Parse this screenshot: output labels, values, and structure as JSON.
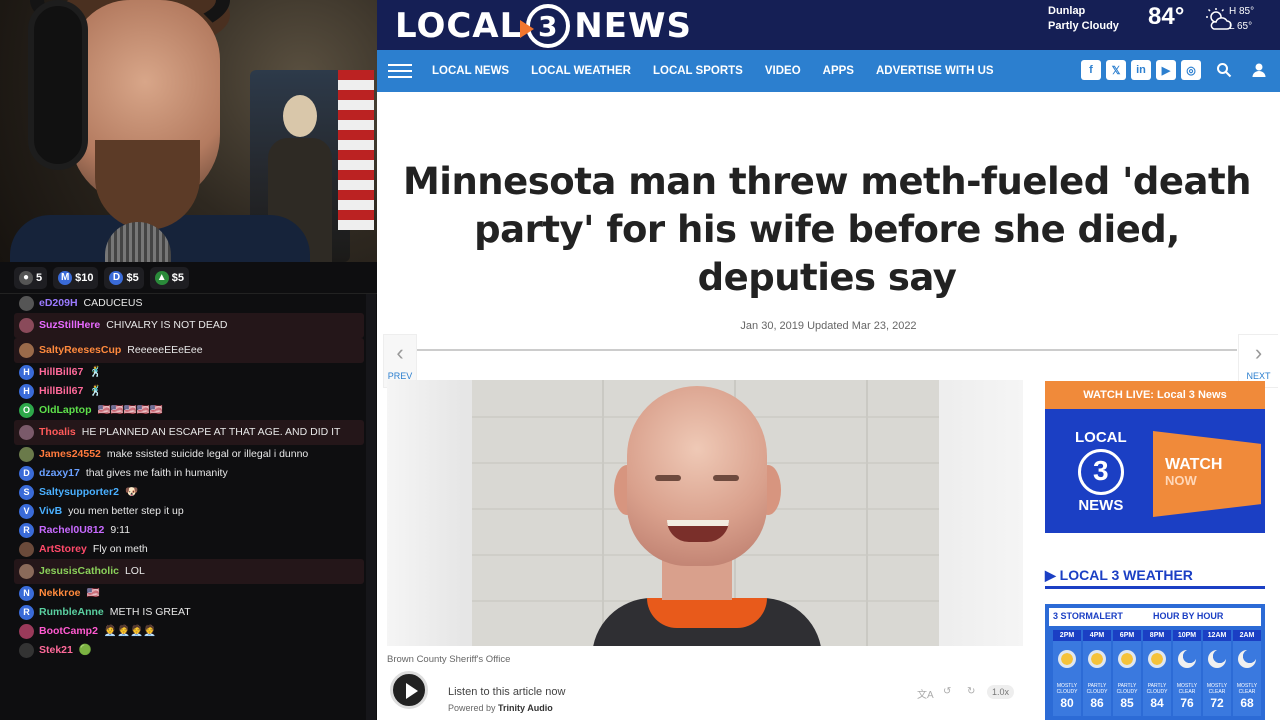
{
  "gifters": [
    {
      "icon": "steam-icon",
      "amount": "5",
      "color": "#555"
    },
    {
      "icon": "m-icon",
      "amount": "$10",
      "color": "#3a6bd8"
    },
    {
      "icon": "d-icon",
      "amount": "$5",
      "color": "#3a6bd8"
    },
    {
      "icon": "tree-icon",
      "amount": "$5",
      "color": "#2a8a3a"
    }
  ],
  "chat": [
    {
      "user": "eD209H",
      "color": "#9b7bff",
      "text": "CADUCEUS",
      "avatar_color": "#555",
      "avatar_letter": "",
      "highlight": false
    },
    {
      "user": "SuzStillHere",
      "color": "#e86aff",
      "text": "CHIVALRY IS NOT DEAD",
      "avatar_color": "#8a4a5a",
      "avatar_letter": "",
      "highlight": true
    },
    {
      "user": "SaltyReesesCup",
      "color": "#ff8a3d",
      "text": "ReeeeeEEeEee",
      "avatar_color": "#9a6a4a",
      "avatar_letter": "",
      "highlight": true
    },
    {
      "user": "HillBill67",
      "color": "#ff6a9a",
      "text": "🕺",
      "avatar_color": "#3a6bd8",
      "avatar_letter": "H",
      "highlight": false
    },
    {
      "user": "HillBill67",
      "color": "#ff6a9a",
      "text": "🕺",
      "avatar_color": "#3a6bd8",
      "avatar_letter": "H",
      "highlight": false
    },
    {
      "user": "OldLaptop",
      "color": "#5de04a",
      "text": "🇺🇸🇺🇸🇺🇸🇺🇸🇺🇸",
      "avatar_color": "#2ea84a",
      "avatar_letter": "O",
      "highlight": false
    },
    {
      "user": "Thoalis",
      "color": "#ff5a5a",
      "text": "HE PLANNED AN ESCAPE AT THAT AGE. AND DID IT",
      "avatar_color": "#7a5a6a",
      "avatar_letter": "",
      "highlight": true
    },
    {
      "user": "James24552",
      "color": "#ff7a3d",
      "text": "make ssisted suicide legal or illegal i dunno",
      "avatar_color": "#6a7a4a",
      "avatar_letter": "",
      "highlight": false
    },
    {
      "user": "dzaxy17",
      "color": "#6aa0ff",
      "text": "that gives me faith in humanity",
      "avatar_color": "#3a6bd8",
      "avatar_letter": "D",
      "highlight": false
    },
    {
      "user": "Saltysupporter2",
      "color": "#4ab0ff",
      "text": "🐶",
      "avatar_color": "#3a6bd8",
      "avatar_letter": "S",
      "highlight": false
    },
    {
      "user": "VivB",
      "color": "#4ab0ff",
      "text": "you men better step it up",
      "avatar_color": "#3a6bd8",
      "avatar_letter": "V",
      "highlight": false
    },
    {
      "user": "Rachel0U812",
      "color": "#c86aff",
      "text": "9:11",
      "avatar_color": "#3a6bd8",
      "avatar_letter": "R",
      "highlight": false
    },
    {
      "user": "ArtStorey",
      "color": "#ff4a6a",
      "text": "Fly on meth",
      "avatar_color": "#6a4a3a",
      "avatar_letter": "",
      "highlight": false
    },
    {
      "user": "JesusisCatholic",
      "color": "#8ad05a",
      "text": "LOL",
      "avatar_color": "#8a6a5a",
      "avatar_letter": "",
      "highlight": true
    },
    {
      "user": "Nekkroe",
      "color": "#ff8a3d",
      "text": "🇺🇸",
      "avatar_color": "#3a6bd8",
      "avatar_letter": "N",
      "highlight": false
    },
    {
      "user": "RumbleAnne",
      "color": "#5ad0a0",
      "text": "METH IS GREAT",
      "avatar_color": "#3a6bd8",
      "avatar_letter": "R",
      "highlight": false
    },
    {
      "user": "BootCamp2",
      "color": "#ff5ad0",
      "text": "🧑‍💼🧑‍💼🧑‍💼🧑‍💼",
      "avatar_color": "#9a3a5a",
      "avatar_letter": "",
      "highlight": false
    },
    {
      "user": "Stek21",
      "color": "#ff6a9a",
      "text": "🟢",
      "avatar_color": "#333",
      "avatar_letter": "",
      "highlight": false
    }
  ],
  "site": {
    "logo_left": "LOCAL",
    "logo_num": "3",
    "logo_right": "NEWS",
    "weather": {
      "city": "Dunlap",
      "condition": "Partly Cloudy",
      "temp": "84°",
      "high": "H 85°",
      "low": "L 65°"
    },
    "nav": [
      "LOCAL NEWS",
      "LOCAL WEATHER",
      "LOCAL SPORTS",
      "VIDEO",
      "APPS",
      "ADVERTISE WITH US"
    ],
    "social": [
      "f",
      "𝕏",
      "in",
      "▶",
      "◎"
    ],
    "headline": "Minnesota man threw meth-fueled 'death party' for his wife before she died, deputies say",
    "dateline": "Jan 30, 2019 Updated Mar 23, 2022",
    "prev_label": "PREV",
    "next_label": "NEXT",
    "photo_credit": "Brown County Sheriff's Office",
    "audio": {
      "listen": "Listen to this article now",
      "powered_prefix": "Powered by",
      "powered_brand": "Trinity Audio",
      "speed": "1.0x"
    },
    "watch_live": {
      "title": "WATCH LIVE: Local 3 News",
      "logo_top": "LOCAL",
      "logo_num": "3",
      "logo_bottom": "NEWS",
      "watch": "WATCH",
      "now": "NOW"
    },
    "weather_widget": {
      "heading": "LOCAL 3 WEATHER",
      "storm_alert": "3 STORMALERT",
      "hour_by_hour": "HOUR BY HOUR",
      "hours": [
        {
          "time": "2PM",
          "cond": "MOSTLY CLOUDY",
          "temp": "80",
          "icon": "sun-cloud-icon"
        },
        {
          "time": "4PM",
          "cond": "PARTLY CLOUDY",
          "temp": "86",
          "icon": "sun-cloud-icon"
        },
        {
          "time": "6PM",
          "cond": "PARTLY CLOUDY",
          "temp": "85",
          "icon": "sun-cloud-icon"
        },
        {
          "time": "8PM",
          "cond": "PARTLY CLOUDY",
          "temp": "84",
          "icon": "sun-cloud-icon"
        },
        {
          "time": "10PM",
          "cond": "MOSTLY CLEAR",
          "temp": "76",
          "icon": "moon-icon"
        },
        {
          "time": "12AM",
          "cond": "MOSTLY CLEAR",
          "temp": "72",
          "icon": "moon-icon"
        },
        {
          "time": "2AM",
          "cond": "MOSTLY CLEAR",
          "temp": "68",
          "icon": "moon-icon"
        }
      ]
    }
  }
}
